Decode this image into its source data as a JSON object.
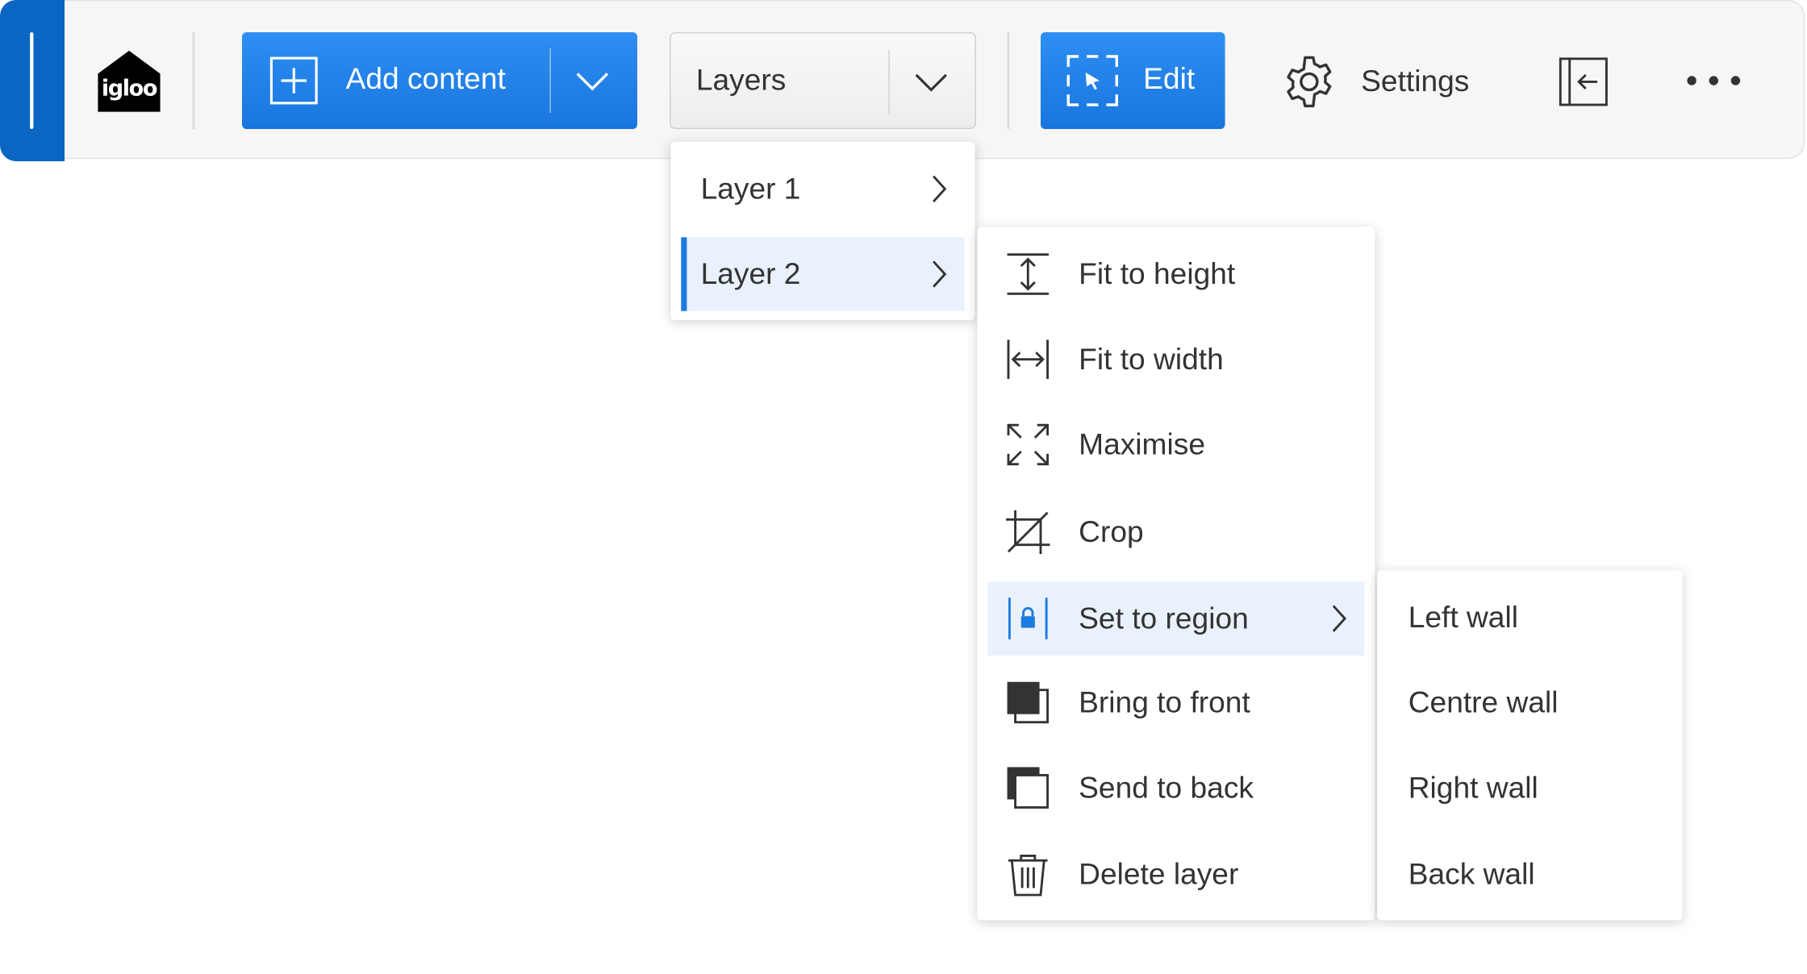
{
  "brand": {
    "logo_text": "igloo",
    "accent_color": "#1876de",
    "handle_color": "#0a66c2"
  },
  "toolbar": {
    "add_content_label": "Add content",
    "layers_label": "Layers",
    "edit_label": "Edit",
    "settings_label": "Settings",
    "icons": {
      "add": "plus-box-icon",
      "dropdown": "chevron-down-icon",
      "edit": "selection-cursor-icon",
      "settings": "gear-icon",
      "collapse": "collapse-panel-icon",
      "more": "more-dots-icon"
    }
  },
  "layers_menu": {
    "items": [
      {
        "label": "Layer 1",
        "selected": false
      },
      {
        "label": "Layer 2",
        "selected": true
      }
    ]
  },
  "actions_menu": {
    "items": [
      {
        "label": "Fit to height",
        "icon": "fit-height-icon"
      },
      {
        "label": "Fit to width",
        "icon": "fit-width-icon"
      },
      {
        "label": "Maximise",
        "icon": "maximise-icon"
      },
      {
        "label": "Crop",
        "icon": "crop-icon"
      },
      {
        "label": "Set to region",
        "icon": "region-lock-icon",
        "selected": true
      },
      {
        "label": "Bring to front",
        "icon": "bring-front-icon"
      },
      {
        "label": "Send to back",
        "icon": "send-back-icon"
      },
      {
        "label": "Delete layer",
        "icon": "trash-icon"
      }
    ]
  },
  "region_menu": {
    "items": [
      {
        "label": "Left wall"
      },
      {
        "label": "Centre wall"
      },
      {
        "label": "Right wall"
      },
      {
        "label": "Back wall"
      }
    ]
  }
}
